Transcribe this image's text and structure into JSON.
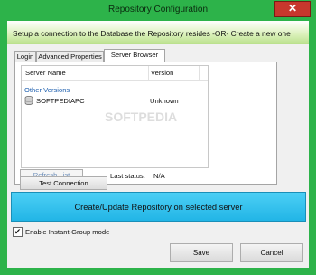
{
  "window": {
    "title": "Repository Configuration",
    "close_glyph": "✕"
  },
  "banner": {
    "text": "Setup a connection to the Database the Repository resides -OR- Create a new one"
  },
  "tabs": [
    {
      "label": "Login"
    },
    {
      "label": "Advanced Properties"
    },
    {
      "label": "Server Browser"
    }
  ],
  "server_list": {
    "columns": [
      "Server Name",
      "Version"
    ],
    "group_label": "Other Versions",
    "rows": [
      {
        "name": "SOFTPEDIAPC",
        "version": "Unknown",
        "icon": "database-icon"
      }
    ]
  },
  "buttons": {
    "refresh": "Refresh List",
    "test_connection": "Test Connection",
    "create_update": "Create/Update Repository on selected server",
    "save": "Save",
    "cancel": "Cancel"
  },
  "status": {
    "label": "Last status:",
    "value": "N/A"
  },
  "options": {
    "instant_group_label": "Enable Instant-Group mode",
    "instant_group_checked": true,
    "check_glyph": "✔"
  },
  "watermark": "SOFTPEDIA"
}
